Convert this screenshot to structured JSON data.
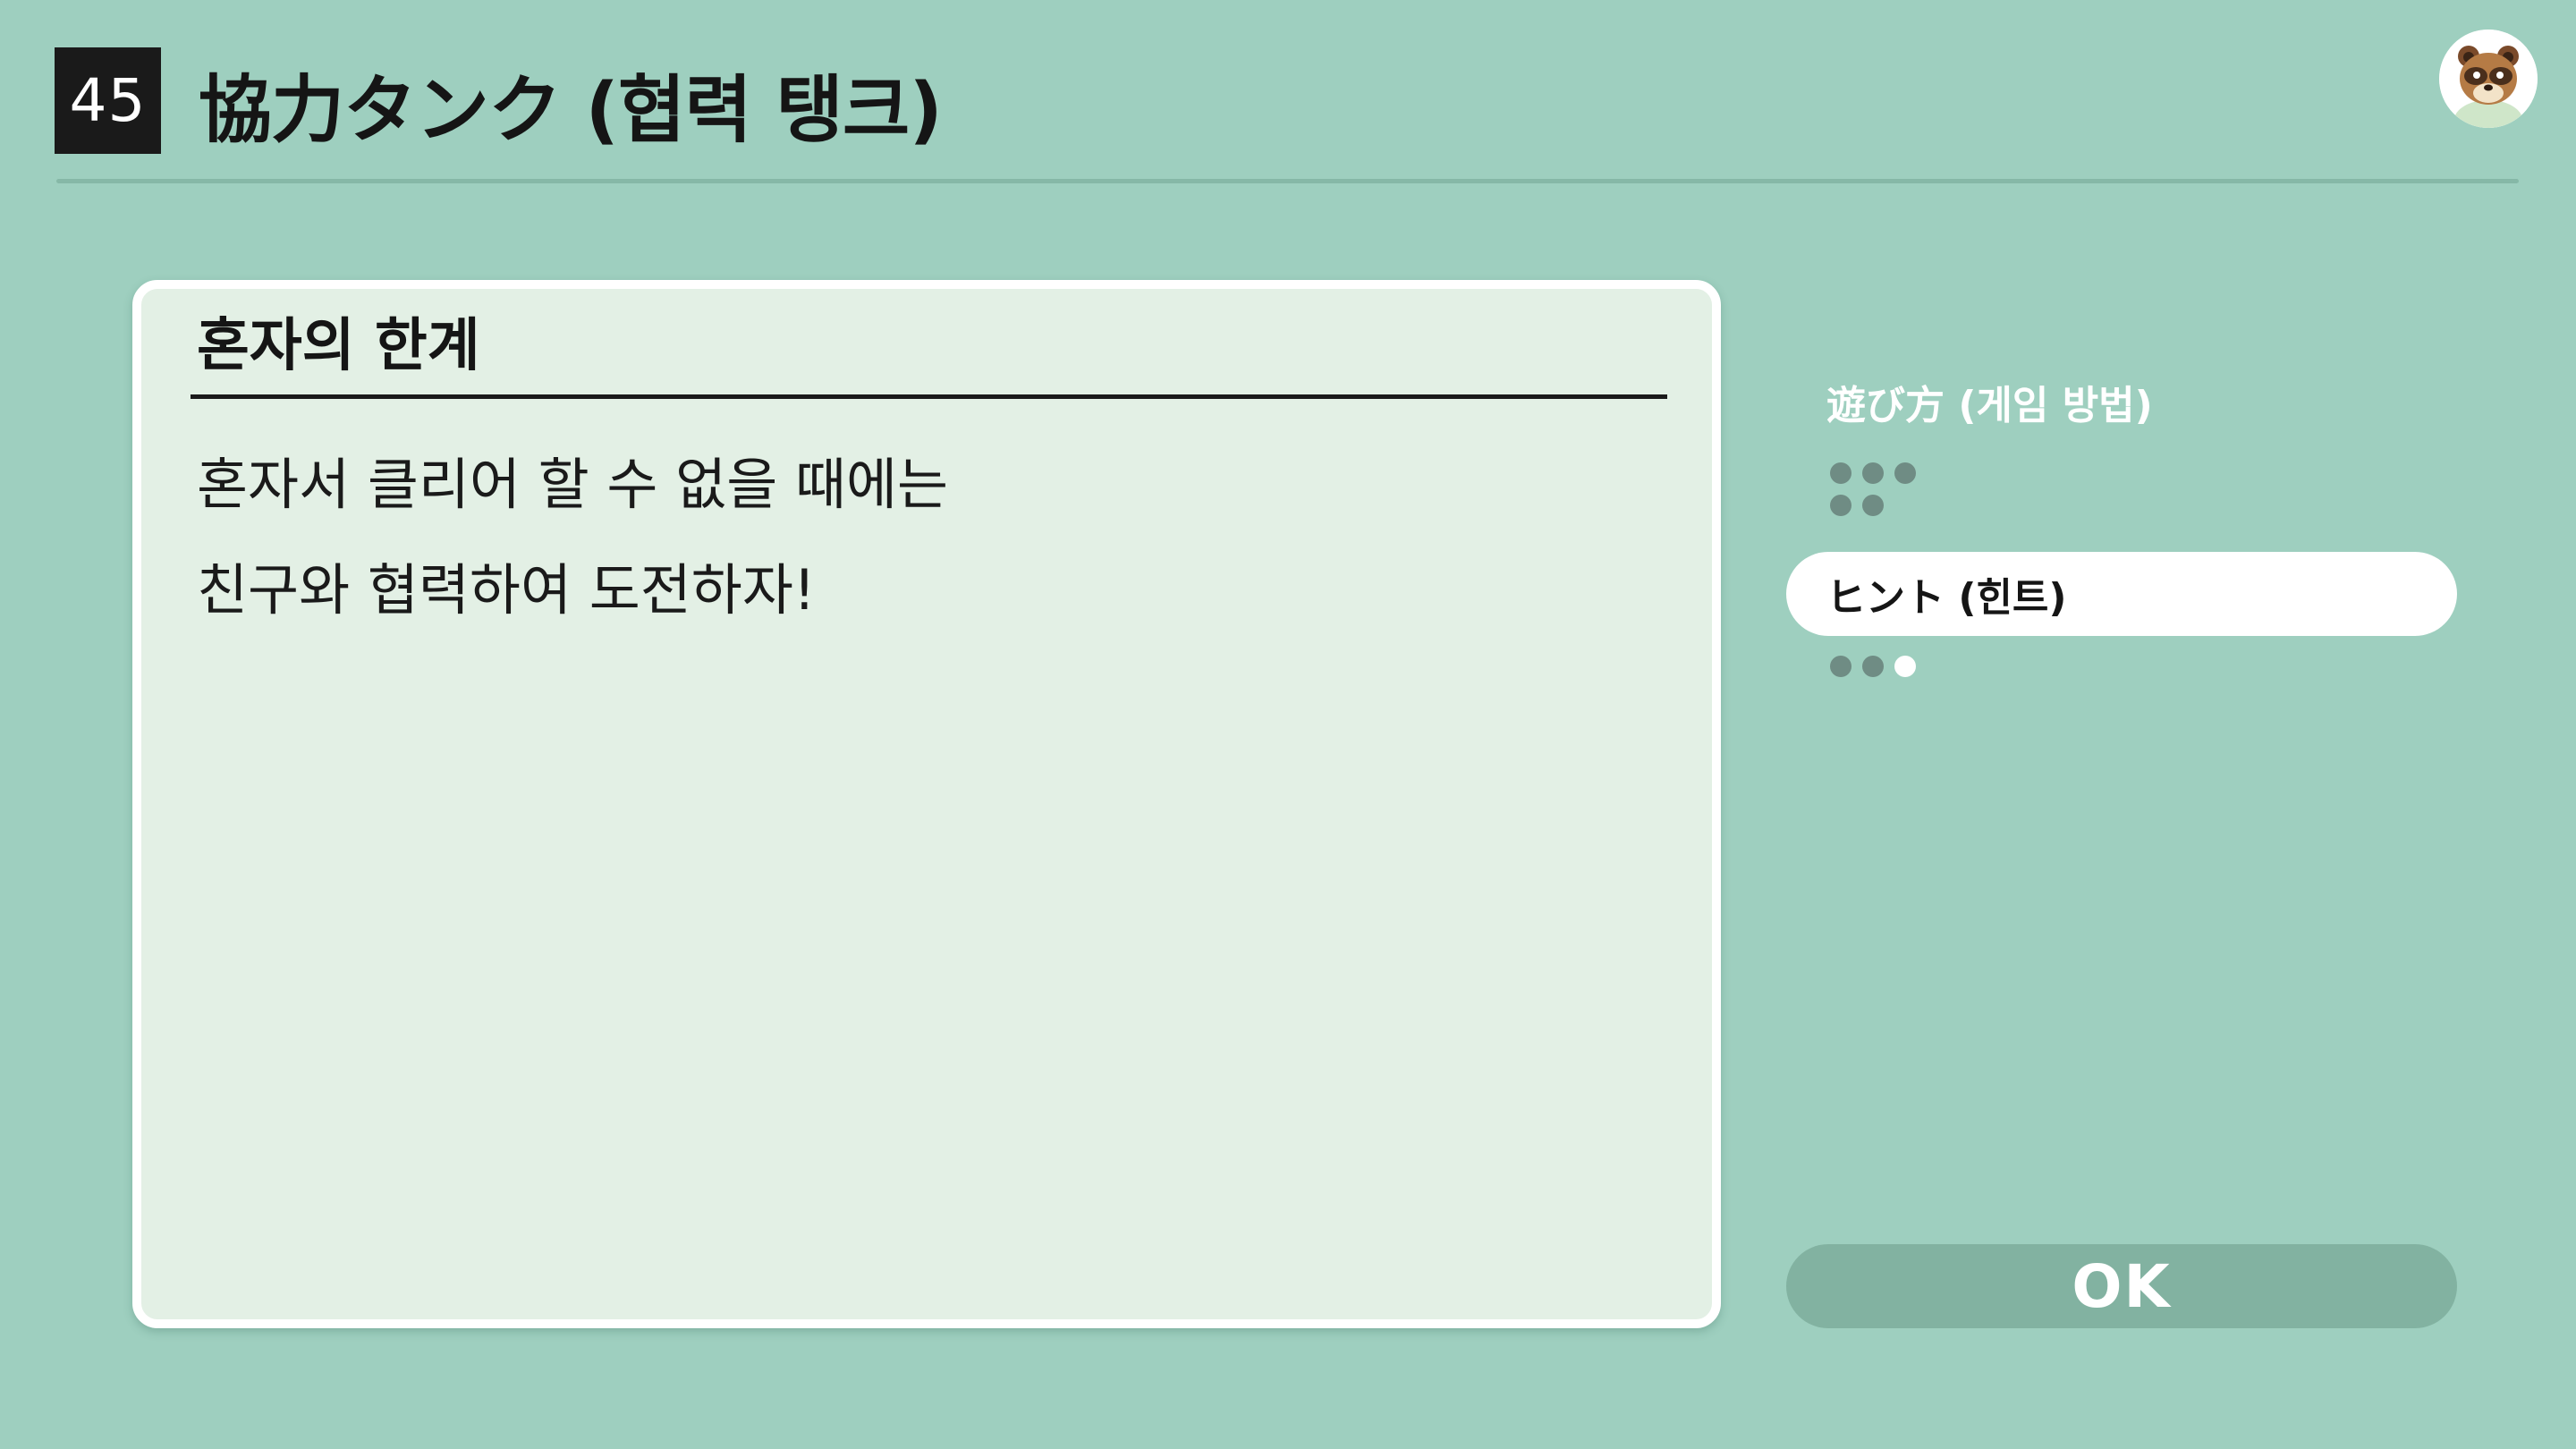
{
  "header": {
    "number": "45",
    "title": "協力タンク (협력 탱크)"
  },
  "avatar": {
    "icon": "tanuki-avatar-icon"
  },
  "panel": {
    "heading": "혼자의 한계",
    "lines": [
      "혼자서 클리어 할 수 없을 때에는",
      "친구와 협력하여 도전하자!"
    ]
  },
  "menu": {
    "items": [
      {
        "label": "遊び方 (게임 방법)",
        "selected": false,
        "pages": 5
      },
      {
        "label": "ヒント (힌트)",
        "selected": true,
        "pages": 3,
        "current_page": 3
      }
    ]
  },
  "ok_button": {
    "label": "OK"
  },
  "colors": {
    "background": "#9ecfbf",
    "panel": "#e3f0e5",
    "button": "#82b2a1",
    "dot": "#6f8c84"
  }
}
